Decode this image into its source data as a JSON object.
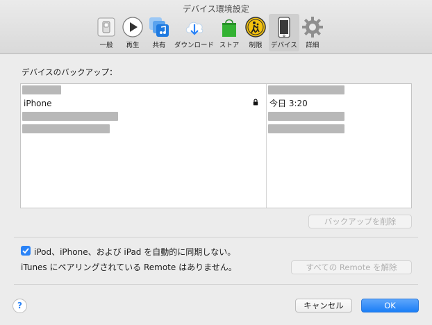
{
  "window": {
    "title": "デバイス環境設定"
  },
  "toolbar": {
    "items": [
      {
        "label": "一般",
        "icon": "general-switch-icon"
      },
      {
        "label": "再生",
        "icon": "play-icon"
      },
      {
        "label": "共有",
        "icon": "music-share-icon"
      },
      {
        "label": "ダウンロード",
        "icon": "download-cloud-icon"
      },
      {
        "label": "ストア",
        "icon": "store-bag-icon"
      },
      {
        "label": "制限",
        "icon": "restrictions-icon"
      },
      {
        "label": "デバイス",
        "icon": "iphone-icon",
        "selected": true
      },
      {
        "label": "詳細",
        "icon": "gear-icon"
      }
    ]
  },
  "backups": {
    "label": "デバイスのバックアップ：",
    "rows": [
      {
        "name": "iPhone",
        "date": "今日 3:20",
        "locked": true
      }
    ],
    "delete_button": "バックアップを削除"
  },
  "sync": {
    "checkbox_label": "iPod、iPhone、および iPad を自動的に同期しない。",
    "checked": true
  },
  "remote": {
    "status": "iTunes にペアリングされている Remote はありません。",
    "reset_button": "すべての Remote を解除"
  },
  "footer": {
    "help": "?",
    "cancel": "キャンセル",
    "ok": "OK"
  },
  "colors": {
    "accent": "#2a83f7",
    "selected_tab": "#cfcfcf"
  }
}
